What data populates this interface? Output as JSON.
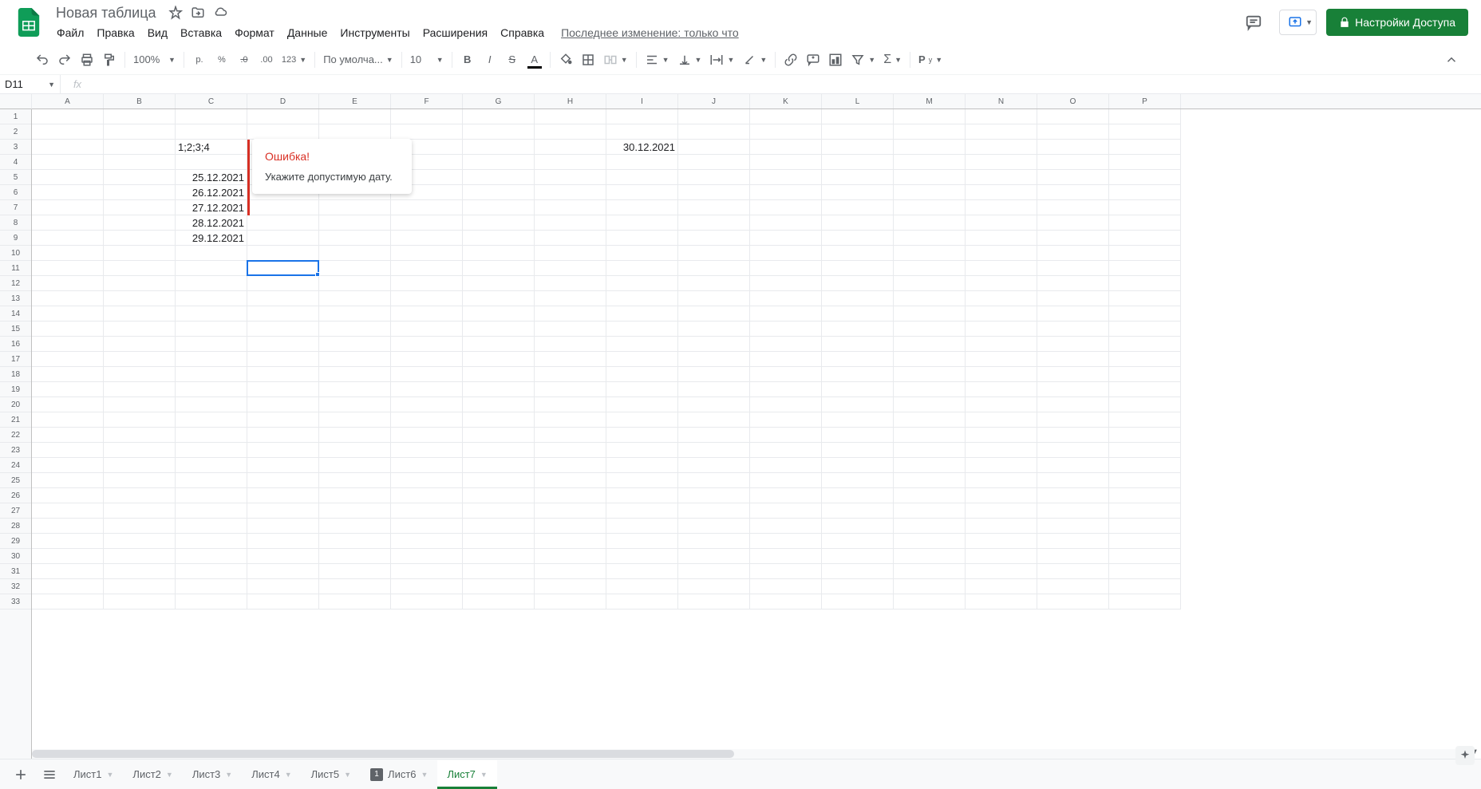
{
  "doc": {
    "title": "Новая таблица",
    "last_change": "Последнее изменение: только что"
  },
  "menu": [
    "Файл",
    "Правка",
    "Вид",
    "Вставка",
    "Формат",
    "Данные",
    "Инструменты",
    "Расширения",
    "Справка"
  ],
  "share": {
    "label": "Настройки Доступа"
  },
  "toolbar": {
    "zoom": "100%",
    "currency": "р.",
    "percent": "%",
    "dec_minus": ".0",
    "dec_plus": ".00",
    "number_fmt": "123",
    "font": "По умолча...",
    "font_size": "10"
  },
  "name_box": "D11",
  "formula": "",
  "columns": [
    "A",
    "B",
    "C",
    "D",
    "E",
    "F",
    "G",
    "H",
    "I",
    "J",
    "K",
    "L",
    "M",
    "N",
    "O",
    "P"
  ],
  "col_width_default": 90,
  "rows_visible": 33,
  "cells": {
    "C3": "1;2;3;4",
    "C5": "25.12.2021",
    "C6": "26.12.2021",
    "C7": "27.12.2021",
    "C8": "28.12.2021",
    "C9": "29.12.2021",
    "I3": "30.12.2021"
  },
  "selection": {
    "col": 3,
    "row": 10
  },
  "error_tooltip": {
    "title": "Ошибка!",
    "message": "Укажите допустимую дату."
  },
  "sheets": [
    {
      "label": "Лист1",
      "badge": null,
      "active": false
    },
    {
      "label": "Лист2",
      "badge": null,
      "active": false
    },
    {
      "label": "Лист3",
      "badge": null,
      "active": false
    },
    {
      "label": "Лист4",
      "badge": null,
      "active": false
    },
    {
      "label": "Лист5",
      "badge": null,
      "active": false
    },
    {
      "label": "Лист6",
      "badge": "1",
      "active": false
    },
    {
      "label": "Лист7",
      "badge": null,
      "active": true
    }
  ]
}
